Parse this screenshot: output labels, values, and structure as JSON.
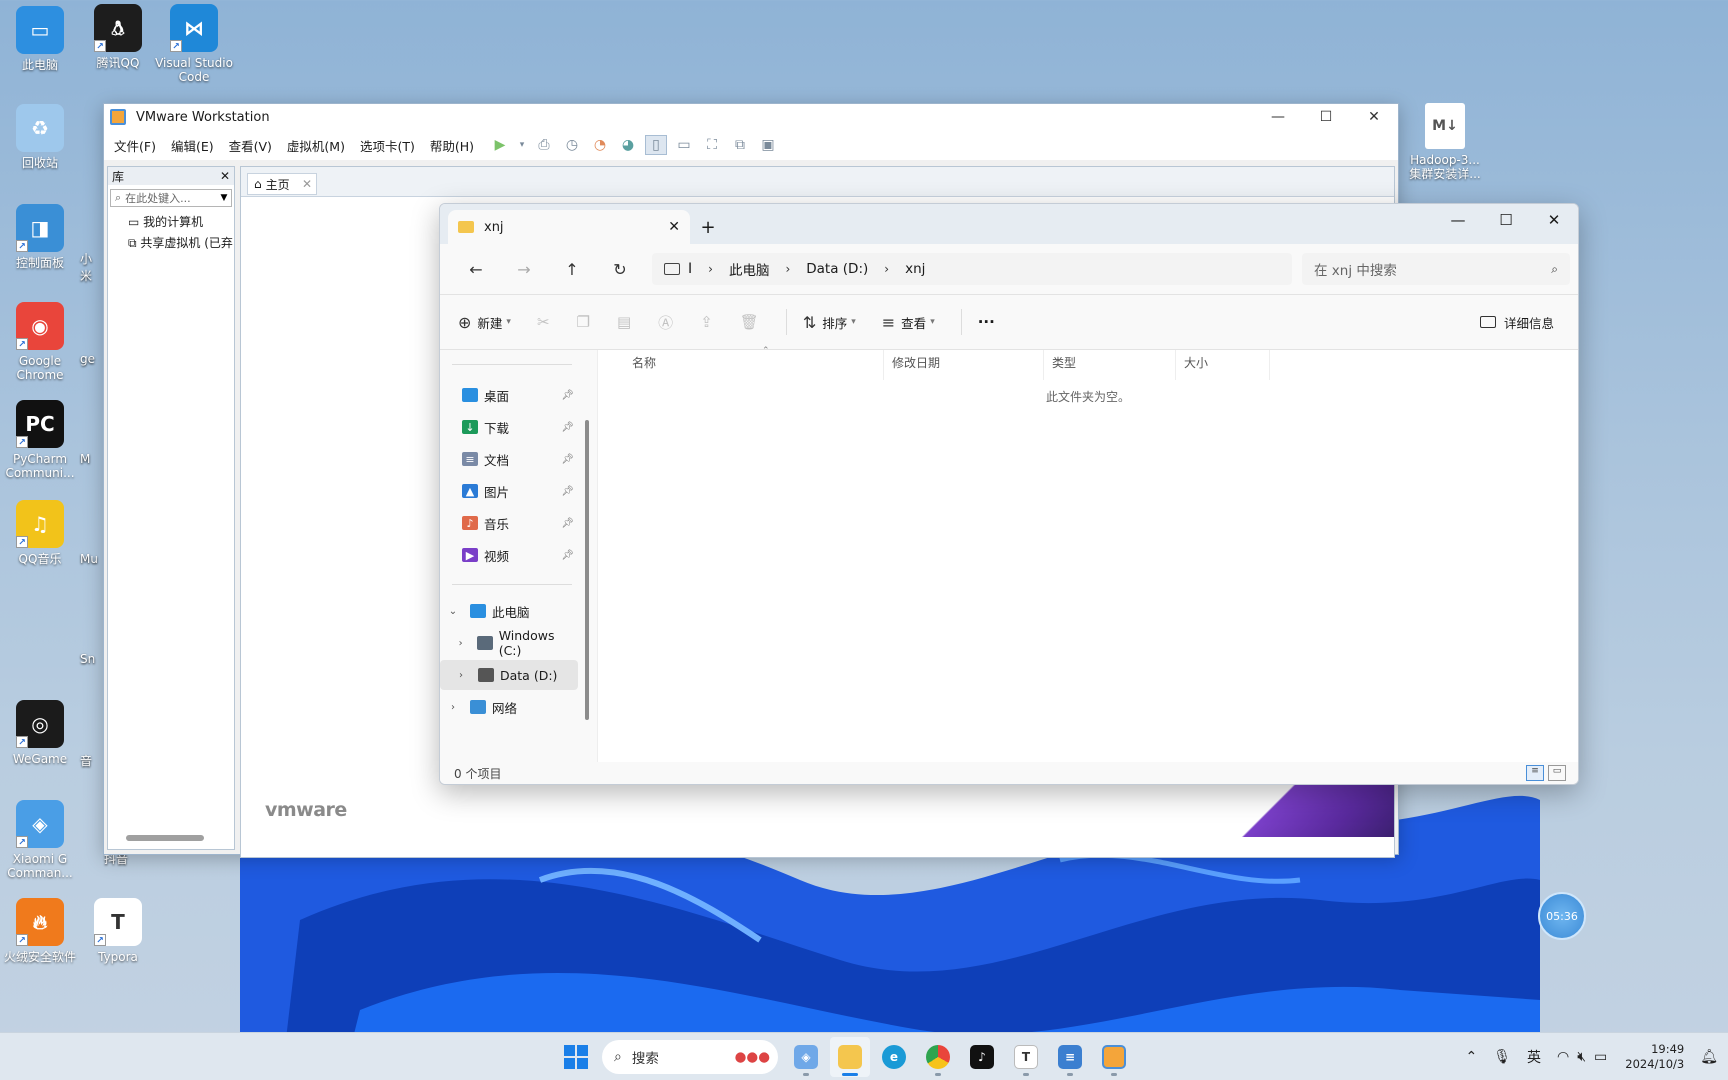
{
  "desktop": {
    "icons_left": [
      {
        "label": "此电脑",
        "color": "#2d8fe0"
      },
      {
        "label": "腾讯QQ",
        "color": "#1d1d1d"
      },
      {
        "label": "Visual Studio Code",
        "color": "#1f88d8"
      },
      {
        "label": "回收站",
        "color": "#9ec8ec"
      },
      {
        "label": "控制面板",
        "color": "#3a8fd6"
      },
      {
        "label": "Google Chrome",
        "color": "#e9453b"
      },
      {
        "label": "PyCharm Communi...",
        "color": "#111111"
      },
      {
        "label": "QQ音乐",
        "color": "#f2c31a"
      },
      {
        "label": "WeGame",
        "color": "#1b1b1b"
      },
      {
        "label": "Xiaomi G Comman...",
        "color": "#4a9ee6"
      },
      {
        "label": "火绒安全软件",
        "color": "#f07a1c"
      },
      {
        "label": "Typora",
        "color": "#ffffff"
      }
    ],
    "partial_labels": [
      "小米",
      "ge",
      "M",
      "Mu",
      "Sn",
      "音",
      "抖音"
    ],
    "right_file": {
      "label": "Hadoop-3...\n集群安装详...",
      "badge": "M↓"
    },
    "timer": "05:36"
  },
  "vmware": {
    "title": "VMware Workstation",
    "menu": [
      "文件(F)",
      "编辑(E)",
      "查看(V)",
      "虚拟机(M)",
      "选项卡(T)",
      "帮助(H)"
    ],
    "library": {
      "header": "库",
      "close": "✕",
      "search_placeholder": "在此处键入...",
      "items": [
        "我的计算机",
        "共享虚拟机 (已弃"
      ]
    },
    "tab": {
      "label": "主页",
      "close": "✕"
    },
    "brand": "vmware"
  },
  "explorer": {
    "tab_title": "xnj",
    "breadcrumb": [
      "此电脑",
      "Data (D:)",
      "xnj"
    ],
    "search_placeholder": "在 xnj 中搜索",
    "commands": {
      "new": "新建",
      "sort": "排序",
      "view": "查看",
      "more": "···",
      "details": "详细信息"
    },
    "sidebar": {
      "quick": [
        {
          "label": "桌面",
          "color": "#2a8fe0",
          "glyph": ""
        },
        {
          "label": "下载",
          "color": "#1c9a5a",
          "glyph": "↓"
        },
        {
          "label": "文档",
          "color": "#7a8aa6",
          "glyph": "≡"
        },
        {
          "label": "图片",
          "color": "#2b7bd6",
          "glyph": "▲"
        },
        {
          "label": "音乐",
          "color": "#e06a4a",
          "glyph": "♪"
        },
        {
          "label": "视频",
          "color": "#7a3fc8",
          "glyph": "▶"
        }
      ],
      "tree": [
        {
          "label": "此电脑",
          "chev": "⌄"
        },
        {
          "label": "Windows (C:)",
          "chev": "›"
        },
        {
          "label": "Data (D:)",
          "chev": "›"
        },
        {
          "label": "网络",
          "chev": "›"
        }
      ]
    },
    "columns": [
      "名称",
      "修改日期",
      "类型",
      "大小"
    ],
    "empty_message": "此文件夹为空。",
    "status": "0 个项目"
  },
  "taskbar": {
    "search": "搜索",
    "tray": {
      "ime": "英",
      "time": "19:49",
      "date": "2024/10/3"
    }
  }
}
